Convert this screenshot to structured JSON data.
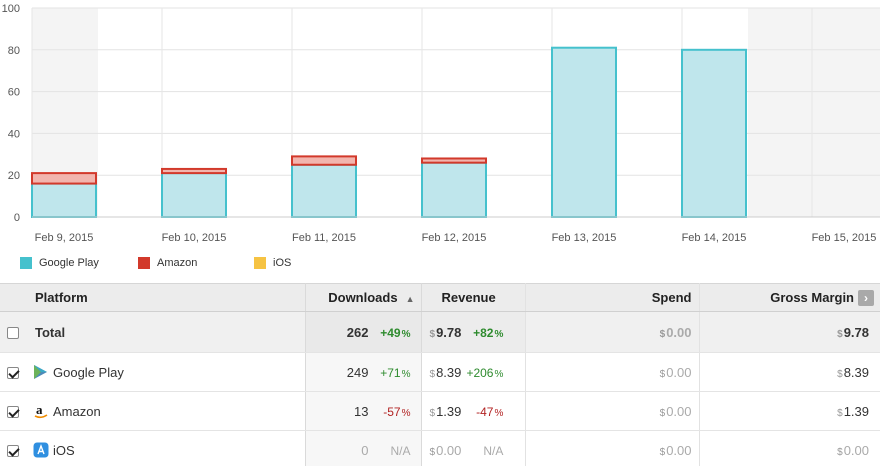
{
  "chart_data": {
    "type": "bar",
    "stacked": true,
    "categories": [
      "Feb 9, 2015",
      "Feb 10, 2015",
      "Feb 11, 2015",
      "Feb 12, 2015",
      "Feb 13, 2015",
      "Feb 14, 2015",
      "Feb 15, 2015"
    ],
    "series": [
      {
        "name": "Google Play",
        "values": [
          16,
          21,
          25,
          26,
          81,
          80,
          0
        ],
        "fill": "#bfe6ec",
        "stroke": "#45c1cd"
      },
      {
        "name": "Amazon",
        "values": [
          5,
          2,
          4,
          2,
          0,
          0,
          0
        ],
        "fill": "#f2b5ae",
        "stroke": "#d2392b"
      },
      {
        "name": "iOS",
        "values": [
          0,
          0,
          0,
          0,
          0,
          0,
          0
        ],
        "fill": "#f6c343",
        "stroke": "#f6c343"
      }
    ],
    "y_ticks": [
      "0",
      "20",
      "40",
      "60",
      "80",
      "100"
    ],
    "ylim": [
      0,
      100
    ],
    "grid": true,
    "weekend_shading_after": "Feb 14, 2015"
  },
  "legend": [
    {
      "label": "Google Play",
      "color": "#45c1cd"
    },
    {
      "label": "Amazon",
      "color": "#d2392b"
    },
    {
      "label": "iOS",
      "color": "#f6c343"
    }
  ],
  "table": {
    "headers": {
      "platform": "Platform",
      "downloads": "Downloads",
      "revenue": "Revenue",
      "spend": "Spend",
      "gross_margin": "Gross Margin"
    },
    "total": {
      "label": "Total",
      "downloads": "262",
      "downloads_change": "+49",
      "revenue": "9.78",
      "revenue_change": "+82",
      "spend": "0.00",
      "gross_margin": "9.78"
    },
    "rows": [
      {
        "platform": "Google Play",
        "downloads": "249",
        "downloads_change": "+71",
        "revenue": "8.39",
        "revenue_change": "+206",
        "spend": "0.00",
        "gross_margin": "8.39"
      },
      {
        "platform": "Amazon",
        "downloads": "13",
        "downloads_change": "-57",
        "revenue": "1.39",
        "revenue_change": "-47",
        "spend": "0.00",
        "gross_margin": "1.39"
      },
      {
        "platform": "iOS",
        "downloads": "0",
        "downloads_change": "N/A",
        "revenue": "0.00",
        "revenue_change": "N/A",
        "spend": "0.00",
        "gross_margin": "0.00"
      }
    ],
    "currency_symbol": "$",
    "percent_symbol": "%"
  }
}
